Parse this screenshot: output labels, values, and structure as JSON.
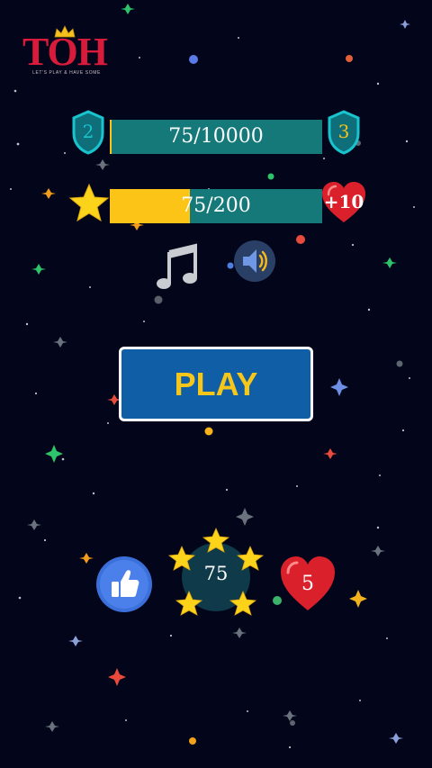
{
  "logo": {
    "title": "TOH",
    "tagline": "LET'S PLAY & HAVE SOME"
  },
  "level": {
    "current": "2",
    "next": "3",
    "progress_text": "75/10000",
    "progress": 0.0075
  },
  "stars": {
    "progress_text": "75/200",
    "progress": 0.375,
    "bonus_label": "+10"
  },
  "audio": {
    "music_icon": "music-note-icon",
    "sound_icon": "speaker-icon"
  },
  "play_button": {
    "label": "PLAY"
  },
  "bottom": {
    "like_icon": "thumbs-up-icon",
    "star_total": "75",
    "lives": "5"
  },
  "colors": {
    "background": "#03051a",
    "bar": "#15797a",
    "fill": "#fbc417",
    "play": "#0f5ea6",
    "heart": "#d9202b",
    "shield": "#18c4cd"
  }
}
